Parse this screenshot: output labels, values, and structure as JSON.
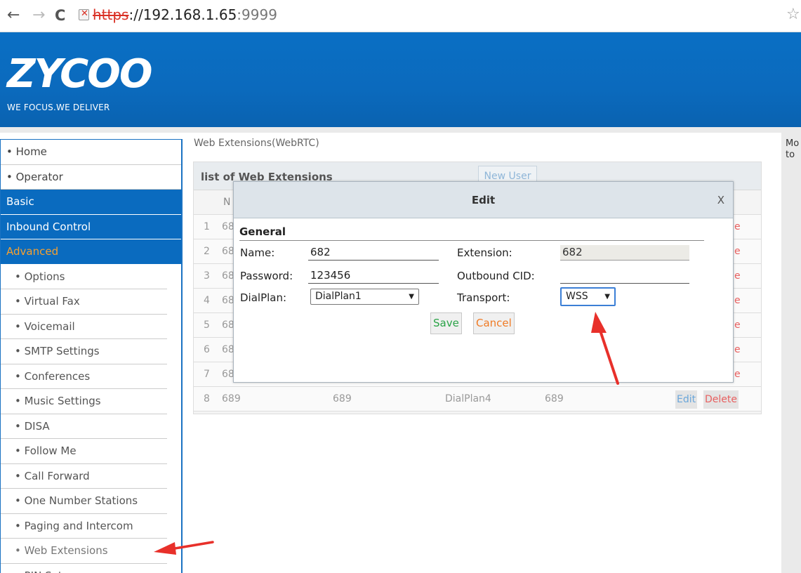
{
  "browser": {
    "url_scheme": "https",
    "url_rest": "://192.168.1.65",
    "url_port": ":9999",
    "back_icon": "←",
    "forward_icon": "→",
    "reload_icon": "C",
    "star_icon": "☆"
  },
  "header": {
    "logo": "ZYCOO",
    "tagline": "WE FOCUS.WE DELIVER"
  },
  "sidebar": {
    "items": [
      {
        "label": "• Home"
      },
      {
        "label": "• Operator"
      },
      {
        "label": "Basic"
      },
      {
        "label": "Inbound Control"
      },
      {
        "label": "Advanced"
      },
      {
        "label": "• Options"
      },
      {
        "label": "• Virtual Fax"
      },
      {
        "label": "• Voicemail"
      },
      {
        "label": "• SMTP Settings"
      },
      {
        "label": "• Conferences"
      },
      {
        "label": "• Music Settings"
      },
      {
        "label": "• DISA"
      },
      {
        "label": "• Follow Me"
      },
      {
        "label": "• Call Forward"
      },
      {
        "label": "• One Number Stations"
      },
      {
        "label": "• Paging and Intercom"
      },
      {
        "label": "• Web Extensions"
      },
      {
        "label": "• PIN Sets"
      }
    ]
  },
  "rightcol": {
    "line1": "Mo",
    "line2": "to"
  },
  "main": {
    "page_title": "Web Extensions(WebRTC)",
    "list_title": "list of Web Extensions",
    "new_user": "New User",
    "col_first": "N",
    "rows": [
      {
        "n": "1",
        "c1": "68"
      },
      {
        "n": "2",
        "c1": "68"
      },
      {
        "n": "3",
        "c1": "68"
      },
      {
        "n": "4",
        "c1": "68"
      },
      {
        "n": "5",
        "c1": "68"
      },
      {
        "n": "6",
        "c1": "68"
      },
      {
        "n": "7",
        "c1": "68"
      }
    ],
    "row8": {
      "n": "8",
      "name": "689",
      "ext": "689",
      "dialplan": "DialPlan4",
      "cid": "689",
      "edit": "Edit",
      "delete": "Delete"
    },
    "del_stub": "e"
  },
  "modal": {
    "title": "Edit",
    "close": "X",
    "section": "General",
    "name_label": "Name:",
    "name_value": "682",
    "password_label": "Password:",
    "password_value": "123456",
    "dialplan_label": "DialPlan:",
    "dialplan_value": "DialPlan1",
    "extension_label": "Extension:",
    "extension_value": "682",
    "outbound_label": "Outbound CID:",
    "outbound_value": "",
    "transport_label": "Transport:",
    "transport_value": "WSS",
    "save": "Save",
    "cancel": "Cancel"
  },
  "colors": {
    "brand_blue": "#0a6bbf",
    "arrow_red": "#e8302a",
    "save_green": "#2aa347",
    "cancel_orange": "#f07b25"
  }
}
